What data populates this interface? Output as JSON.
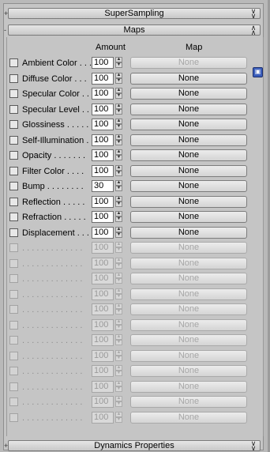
{
  "rollouts": {
    "supersampling": {
      "title": "SuperSampling",
      "sign": "+"
    },
    "maps": {
      "title": "Maps",
      "sign": "-"
    },
    "dynamics": {
      "title": "Dynamics Properties",
      "sign": "+"
    }
  },
  "columns": {
    "amount": "Amount",
    "map": "Map"
  },
  "rows": [
    {
      "label": "Ambient Color . . .",
      "amount": "100",
      "map": "None",
      "enabled": true,
      "map_enabled": false
    },
    {
      "label": "Diffuse Color . . .",
      "amount": "100",
      "map": "None",
      "enabled": true,
      "map_enabled": true
    },
    {
      "label": "Specular Color . .",
      "amount": "100",
      "map": "None",
      "enabled": true,
      "map_enabled": true
    },
    {
      "label": "Specular Level . .",
      "amount": "100",
      "map": "None",
      "enabled": true,
      "map_enabled": true
    },
    {
      "label": "Glossiness . . . . .",
      "amount": "100",
      "map": "None",
      "enabled": true,
      "map_enabled": true
    },
    {
      "label": "Self-Illumination .",
      "amount": "100",
      "map": "None",
      "enabled": true,
      "map_enabled": true
    },
    {
      "label": "Opacity . . . . . . .",
      "amount": "100",
      "map": "None",
      "enabled": true,
      "map_enabled": true
    },
    {
      "label": "Filter Color . . . .",
      "amount": "100",
      "map": "None",
      "enabled": true,
      "map_enabled": true
    },
    {
      "label": "Bump . . . . . . . .",
      "amount": "30",
      "map": "None",
      "enabled": true,
      "map_enabled": true
    },
    {
      "label": "Reflection . . . . .",
      "amount": "100",
      "map": "None",
      "enabled": true,
      "map_enabled": true
    },
    {
      "label": "Refraction . . . . .",
      "amount": "100",
      "map": "None",
      "enabled": true,
      "map_enabled": true
    },
    {
      "label": "Displacement . . .",
      "amount": "100",
      "map": "None",
      "enabled": true,
      "map_enabled": true
    },
    {
      "label": ". . . . . . . . . . . . .",
      "amount": "100",
      "map": "None",
      "enabled": false,
      "map_enabled": false
    },
    {
      "label": ". . . . . . . . . . . . .",
      "amount": "100",
      "map": "None",
      "enabled": false,
      "map_enabled": false
    },
    {
      "label": ". . . . . . . . . . . . .",
      "amount": "100",
      "map": "None",
      "enabled": false,
      "map_enabled": false
    },
    {
      "label": ". . . . . . . . . . . . .",
      "amount": "100",
      "map": "None",
      "enabled": false,
      "map_enabled": false
    },
    {
      "label": ". . . . . . . . . . . . .",
      "amount": "100",
      "map": "None",
      "enabled": false,
      "map_enabled": false
    },
    {
      "label": ". . . . . . . . . . . . .",
      "amount": "100",
      "map": "None",
      "enabled": false,
      "map_enabled": false
    },
    {
      "label": ". . . . . . . . . . . . .",
      "amount": "100",
      "map": "None",
      "enabled": false,
      "map_enabled": false
    },
    {
      "label": ". . . . . . . . . . . . .",
      "amount": "100",
      "map": "None",
      "enabled": false,
      "map_enabled": false
    },
    {
      "label": ". . . . . . . . . . . . .",
      "amount": "100",
      "map": "None",
      "enabled": false,
      "map_enabled": false
    },
    {
      "label": ". . . . . . . . . . . . .",
      "amount": "100",
      "map": "None",
      "enabled": false,
      "map_enabled": false
    },
    {
      "label": ". . . . . . . . . . . . .",
      "amount": "100",
      "map": "None",
      "enabled": false,
      "map_enabled": false
    },
    {
      "label": ". . . . . . . . . . . . .",
      "amount": "100",
      "map": "None",
      "enabled": false,
      "map_enabled": false
    }
  ],
  "icons": {
    "lock": "lock-icon",
    "collapse": "chevron-up-icon",
    "expand": "chevron-down-icon"
  },
  "colors": {
    "panel": "#c5c5c5",
    "lock": "#3a5dbb"
  }
}
